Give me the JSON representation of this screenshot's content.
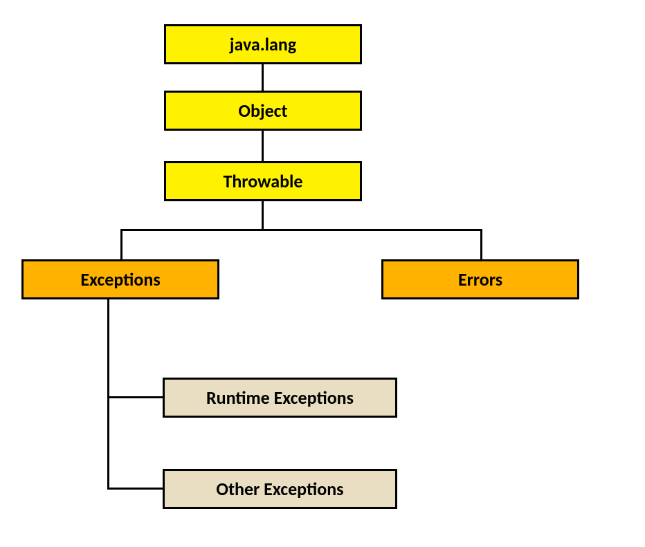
{
  "boxes": {
    "javalang": "java.lang",
    "object": "Object",
    "throwable": "Throwable",
    "exceptions": "Exceptions",
    "errors": "Errors",
    "runtime": "Runtime Exceptions",
    "other": "Other Exceptions"
  }
}
